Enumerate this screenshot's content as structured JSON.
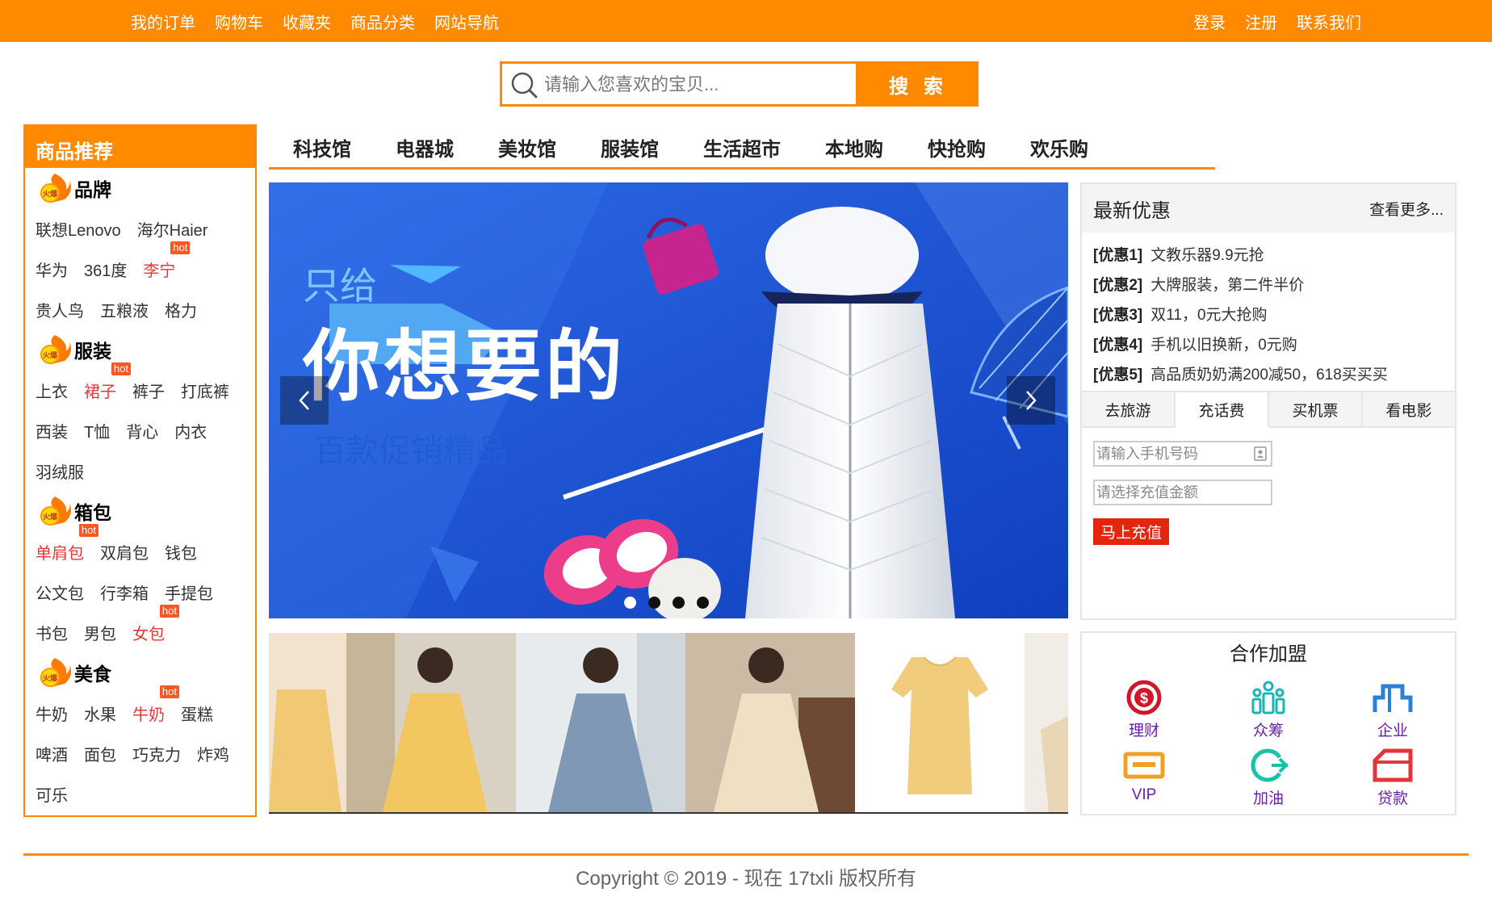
{
  "topnav": {
    "left": [
      "我的订单",
      "购物车",
      "收藏夹",
      "商品分类",
      "网站导航"
    ],
    "right": [
      "登录",
      "注册",
      "联系我们"
    ]
  },
  "search": {
    "placeholder": "请输入您喜欢的宝贝...",
    "button": "搜 索"
  },
  "recommend": {
    "title": "商品推荐",
    "categories": [
      {
        "name": "品牌",
        "rows": [
          [
            {
              "t": "联想Lenovo"
            },
            {
              "t": "海尔Haier"
            }
          ],
          [
            {
              "t": "华为"
            },
            {
              "t": "361度"
            },
            {
              "t": "李宁",
              "red": true,
              "hot": true
            }
          ],
          [
            {
              "t": "贵人鸟"
            },
            {
              "t": "五粮液"
            },
            {
              "t": "格力"
            }
          ]
        ]
      },
      {
        "name": "服装",
        "rows": [
          [
            {
              "t": "上衣"
            },
            {
              "t": "裙子",
              "red": true,
              "hot": true
            },
            {
              "t": "裤子"
            },
            {
              "t": "打底裤"
            }
          ],
          [
            {
              "t": "西装"
            },
            {
              "t": "T恤"
            },
            {
              "t": "背心"
            },
            {
              "t": "内衣"
            }
          ],
          [
            {
              "t": "羽绒服"
            }
          ]
        ]
      },
      {
        "name": "箱包",
        "rows": [
          [
            {
              "t": "单肩包",
              "red": true,
              "hot": true
            },
            {
              "t": "双肩包"
            },
            {
              "t": "钱包"
            }
          ],
          [
            {
              "t": "公文包"
            },
            {
              "t": "行李箱"
            },
            {
              "t": "手提包"
            }
          ],
          [
            {
              "t": "书包"
            },
            {
              "t": "男包"
            },
            {
              "t": "女包",
              "red": true,
              "hot": true
            }
          ]
        ]
      },
      {
        "name": "美食",
        "rows": [
          [
            {
              "t": "牛奶"
            },
            {
              "t": "水果"
            },
            {
              "t": "牛奶",
              "red": true,
              "hot": true
            },
            {
              "t": "蛋糕"
            }
          ],
          [
            {
              "t": "啤酒"
            },
            {
              "t": "面包"
            },
            {
              "t": "巧克力"
            },
            {
              "t": "炸鸡"
            }
          ],
          [
            {
              "t": "可乐"
            }
          ]
        ]
      }
    ],
    "hot_label": "hot",
    "fire_label": "火爆"
  },
  "tabs": [
    "科技馆",
    "电器城",
    "美妆馆",
    "服装馆",
    "生活超市",
    "本地购",
    "快抢购",
    "欢乐购"
  ],
  "banner": {
    "line1": "只给",
    "line2": "你想要的",
    "line3": "百款促销精品",
    "dots": 4,
    "active_dot": 0
  },
  "deals": {
    "title": "最新优惠",
    "more": "查看更多...",
    "items": [
      {
        "tag": "[优惠1]",
        "text": "文教乐器9.9元抢"
      },
      {
        "tag": "[优惠2]",
        "text": "大牌服装，第二件半价"
      },
      {
        "tag": "[优惠3]",
        "text": "双11，0元大抢购"
      },
      {
        "tag": "[优惠4]",
        "text": "手机以旧换新，0元购"
      },
      {
        "tag": "[优惠5]",
        "text": "高品质奶奶满200减50，618买买买"
      }
    ],
    "tabs": [
      "去旅游",
      "充话费",
      "买机票",
      "看电影"
    ],
    "active_tab": 1,
    "phone_placeholder": "请输入手机号码",
    "amount_placeholder": "请选择充值金额",
    "recharge_button": "马上充值"
  },
  "join": {
    "title": "合作加盟",
    "items": [
      {
        "label": "理财",
        "icon": "money-icon",
        "color": "#d0182a"
      },
      {
        "label": "众筹",
        "icon": "crowd-icon",
        "color": "#19b5b5"
      },
      {
        "label": "企业",
        "icon": "building-icon",
        "color": "#2a7fd6"
      },
      {
        "label": "VIP",
        "icon": "vip-card-icon",
        "color": "#f2a024"
      },
      {
        "label": "加油",
        "icon": "fuel-icon",
        "color": "#19c2a6"
      },
      {
        "label": "贷款",
        "icon": "loan-icon",
        "color": "#e0353a"
      }
    ]
  },
  "footer": {
    "copyright": "Copyright © 2019 - 现在 17txli 版权所有"
  },
  "colors": {
    "accent": "#ff8a00",
    "hot": "#e4393c",
    "recharge": "#e4260f"
  }
}
